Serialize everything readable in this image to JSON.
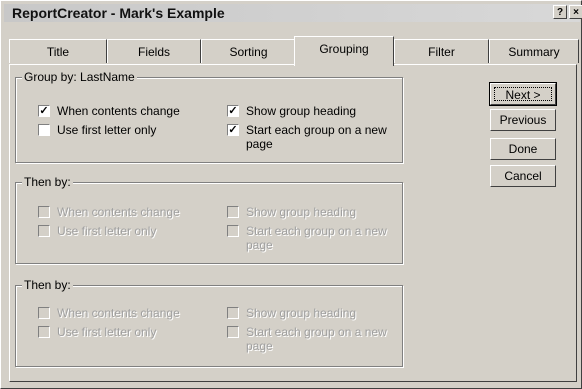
{
  "window": {
    "title": "ReportCreator - Mark's Example",
    "help": "?",
    "close": "×"
  },
  "tabs": [
    "Title",
    "Fields",
    "Sorting",
    "Grouping",
    "Filter",
    "Summary"
  ],
  "active_tab": "Grouping",
  "groups": [
    {
      "legend": "Group by: LastName",
      "enabled": true,
      "opts": {
        "when_changes": "When contents change",
        "first_letter": "Use first letter only",
        "show_heading": "Show group heading",
        "new_page": "Start each group on a new page"
      },
      "checked": {
        "when_changes": true,
        "first_letter": false,
        "show_heading": true,
        "new_page": true
      }
    },
    {
      "legend": "Then by:",
      "enabled": false,
      "opts": {
        "when_changes": "When contents change",
        "first_letter": "Use first letter only",
        "show_heading": "Show group heading",
        "new_page": "Start each group on a new page"
      },
      "checked": {
        "when_changes": false,
        "first_letter": false,
        "show_heading": false,
        "new_page": false
      }
    },
    {
      "legend": "Then by:",
      "enabled": false,
      "opts": {
        "when_changes": "When contents change",
        "first_letter": "Use first letter only",
        "show_heading": "Show group heading",
        "new_page": "Start each group on a new page"
      },
      "checked": {
        "when_changes": false,
        "first_letter": false,
        "show_heading": false,
        "new_page": false
      }
    }
  ],
  "buttons": {
    "next": "Next >",
    "previous": "Previous",
    "done": "Done",
    "cancel": "Cancel"
  }
}
